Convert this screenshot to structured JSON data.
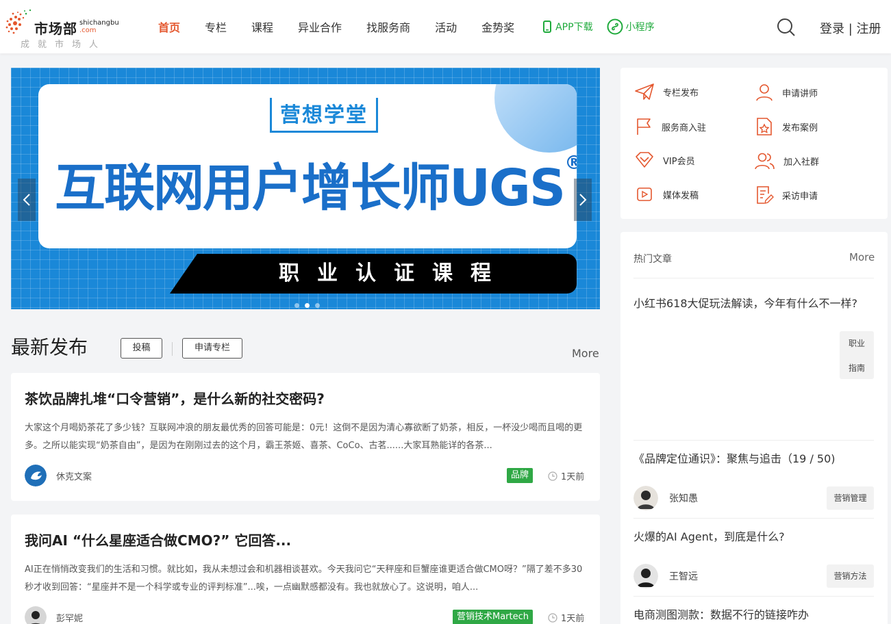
{
  "brand": {
    "name_cn": "市场部",
    "name_en": "shichangbu",
    "name_domain": ".com",
    "slogan": "成就市场人",
    "accent": "#e4572e",
    "green": "#1faa3c"
  },
  "nav": {
    "items": [
      "首页",
      "专栏",
      "课程",
      "异业合作",
      "找服务商",
      "活动",
      "金势奖"
    ],
    "app_label": "APP下载",
    "mini_label": "小程序",
    "login": "登录",
    "separator": "|",
    "register": "注册"
  },
  "banner": {
    "brand": "营想学堂",
    "headline": "互联网用户增长师UGS",
    "registered": "®",
    "subline": "职业认证课程",
    "slides": 3,
    "active_slide": 2
  },
  "latest": {
    "title": "最新发布",
    "btn_submit": "投稿",
    "btn_apply": "申请专栏",
    "more": "More",
    "articles": [
      {
        "title": "茶饮品牌扎堆“口令营销”，是什么新的社交密码?",
        "excerpt": "大家这个月喝奶茶花了多少钱？互联网冲浪的朋友最优秀的回答可能是：0元！这倒不是因为清心寡欲断了奶茶，相反，一杯没少喝而且喝的更多。之所以能实现“奶茶自由”，是因为在刚刚过去的这个月，霸王茶姬、喜茶、CoCo、古茗......大家耳熟能详的各茶...",
        "author": "休克文案",
        "tag": "品牌",
        "time": "1天前"
      },
      {
        "title": "我问AI “什么星座适合做CMO?” 它回答...",
        "excerpt": "AI正在悄悄改变我们的生活和习惯。就比如，我从未想过会和机器相谈甚欢。今天我问它“天秤座和巨蟹座谁更适合做CMO呀？”隔了差不多30秒才收到回答：“星座并不是一个科学或专业的评判标准”...唉，一点幽默感都没有。我也就放心了。这说明，咱人...",
        "author": "彭罕妮",
        "tag": "营销技术Martech",
        "time": "1天前"
      }
    ]
  },
  "quick_links": [
    "专栏发布",
    "申请讲师",
    "服务商入驻",
    "发布案例",
    "VIP会员",
    "加入社群",
    "媒体发稿",
    "采访申请"
  ],
  "hot": {
    "title": "热门文章",
    "more": "More",
    "items": [
      {
        "title": "小红书618大促玩法解读，今年有什么不一样?",
        "tag_line1": "职业",
        "tag_line2": "指南"
      },
      {
        "title": "《品牌定位通识》：聚焦与追击（19 / 50)",
        "author": "张知愚",
        "tag": "营销管理"
      },
      {
        "title": "火爆的AI Agent，到底是什么?",
        "author": "王智远",
        "tag": "营销方法"
      },
      {
        "title": "电商测图测款：数据不行的链接咋办"
      }
    ]
  }
}
